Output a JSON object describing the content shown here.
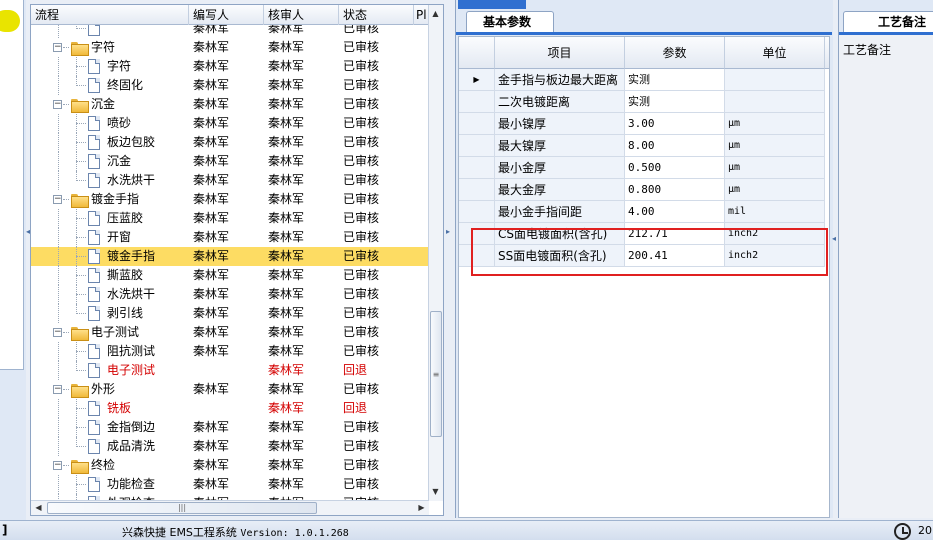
{
  "tree": {
    "columns": [
      "流程",
      "编写人",
      "核审人",
      "状态",
      "Pl"
    ],
    "rows": [
      {
        "name": "",
        "type": "doc",
        "level": 2,
        "writer": "秦林军",
        "reviewer": "秦林军",
        "status": "已审核"
      },
      {
        "name": "字符",
        "type": "folder",
        "level": 1,
        "writer": "秦林军",
        "reviewer": "秦林军",
        "status": "已审核"
      },
      {
        "name": "字符",
        "type": "doc",
        "level": 2,
        "writer": "秦林军",
        "reviewer": "秦林军",
        "status": "已审核"
      },
      {
        "name": "终固化",
        "type": "doc",
        "level": 2,
        "writer": "秦林军",
        "reviewer": "秦林军",
        "status": "已审核"
      },
      {
        "name": "沉金",
        "type": "folder",
        "level": 1,
        "writer": "秦林军",
        "reviewer": "秦林军",
        "status": "已审核"
      },
      {
        "name": "喷砂",
        "type": "doc",
        "level": 2,
        "writer": "秦林军",
        "reviewer": "秦林军",
        "status": "已审核"
      },
      {
        "name": "板边包胶",
        "type": "doc",
        "level": 2,
        "writer": "秦林军",
        "reviewer": "秦林军",
        "status": "已审核"
      },
      {
        "name": "沉金",
        "type": "doc",
        "level": 2,
        "writer": "秦林军",
        "reviewer": "秦林军",
        "status": "已审核"
      },
      {
        "name": "水洗烘干",
        "type": "doc",
        "level": 2,
        "writer": "秦林军",
        "reviewer": "秦林军",
        "status": "已审核"
      },
      {
        "name": "镀金手指",
        "type": "folder",
        "level": 1,
        "writer": "秦林军",
        "reviewer": "秦林军",
        "status": "已审核"
      },
      {
        "name": "压蓝胶",
        "type": "doc",
        "level": 2,
        "writer": "秦林军",
        "reviewer": "秦林军",
        "status": "已审核"
      },
      {
        "name": "开窗",
        "type": "doc",
        "level": 2,
        "writer": "秦林军",
        "reviewer": "秦林军",
        "status": "已审核"
      },
      {
        "name": "镀金手指",
        "type": "doc",
        "level": 2,
        "writer": "秦林军",
        "reviewer": "秦林军",
        "status": "已审核",
        "selected": true
      },
      {
        "name": "撕蓝胶",
        "type": "doc",
        "level": 2,
        "writer": "秦林军",
        "reviewer": "秦林军",
        "status": "已审核"
      },
      {
        "name": "水洗烘干",
        "type": "doc",
        "level": 2,
        "writer": "秦林军",
        "reviewer": "秦林军",
        "status": "已审核"
      },
      {
        "name": "剥引线",
        "type": "doc",
        "level": 2,
        "writer": "秦林军",
        "reviewer": "秦林军",
        "status": "已审核"
      },
      {
        "name": "电子测试",
        "type": "folder",
        "level": 1,
        "writer": "秦林军",
        "reviewer": "秦林军",
        "status": "已审核"
      },
      {
        "name": "阻抗测试",
        "type": "doc",
        "level": 2,
        "writer": "秦林军",
        "reviewer": "秦林军",
        "status": "已审核"
      },
      {
        "name": "电子测试",
        "type": "doc",
        "level": 2,
        "writer": "",
        "reviewer": "秦林军",
        "status": "回退",
        "red": true
      },
      {
        "name": "外形",
        "type": "folder",
        "level": 1,
        "writer": "秦林军",
        "reviewer": "秦林军",
        "status": "已审核"
      },
      {
        "name": "铣板",
        "type": "doc",
        "level": 2,
        "writer": "",
        "reviewer": "秦林军",
        "status": "回退",
        "red": true
      },
      {
        "name": "金指倒边",
        "type": "doc",
        "level": 2,
        "writer": "秦林军",
        "reviewer": "秦林军",
        "status": "已审核"
      },
      {
        "name": "成品清洗",
        "type": "doc",
        "level": 2,
        "writer": "秦林军",
        "reviewer": "秦林军",
        "status": "已审核"
      },
      {
        "name": "终检",
        "type": "folder",
        "level": 1,
        "writer": "秦林军",
        "reviewer": "秦林军",
        "status": "已审核"
      },
      {
        "name": "功能检查",
        "type": "doc",
        "level": 2,
        "writer": "秦林军",
        "reviewer": "秦林军",
        "status": "已审核"
      },
      {
        "name": "外观检查",
        "type": "doc",
        "level": 2,
        "writer": "秦林军",
        "reviewer": "秦林军",
        "status": "已审核"
      }
    ]
  },
  "params": {
    "tab_label": "基本参数",
    "columns": [
      "项目",
      "参数",
      "单位"
    ],
    "rows": [
      {
        "item": "金手指与板边最大距离",
        "value": "实测",
        "unit": "",
        "current": true
      },
      {
        "item": "二次电镀距离",
        "value": "实测",
        "unit": ""
      },
      {
        "item": "最小镍厚",
        "value": "3.00",
        "unit": "μm"
      },
      {
        "item": "最大镍厚",
        "value": "8.00",
        "unit": "μm"
      },
      {
        "item": "最小金厚",
        "value": "0.500",
        "unit": "μm"
      },
      {
        "item": "最大金厚",
        "value": "0.800",
        "unit": "μm"
      },
      {
        "item": "最小金手指间距",
        "value": "4.00",
        "unit": "mil"
      },
      {
        "item": "CS面电镀面积(含孔)",
        "value": "212.71",
        "unit": "inch2"
      },
      {
        "item": "SS面电镀面积(含孔)",
        "value": "200.41",
        "unit": "inch2"
      }
    ]
  },
  "notes": {
    "tab_label": "工艺备注",
    "field_label": "工艺备注"
  },
  "status_bar": {
    "left_glyph": "]",
    "app_name": "兴森快捷 EMS工程系统",
    "version_label": "Version: 1.0.1.268",
    "right_text": "20"
  },
  "colors": {
    "selected_row": "#fddc63",
    "rejected_text": "#d40000",
    "highlight_box": "#e02020",
    "tab_accent": "#2f6fd0"
  }
}
